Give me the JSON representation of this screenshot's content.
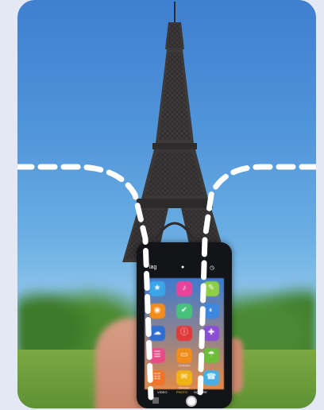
{
  "camera_ui": {
    "top_bar": {
      "hdr": "iag",
      "flash": "●",
      "timer": "◷"
    },
    "apps": [
      {
        "glyph": "★",
        "color": "#3aa5e8",
        "label": ""
      },
      {
        "glyph": "♪",
        "color": "#e8449b",
        "label": ""
      },
      {
        "glyph": "✎",
        "color": "#8fcf46",
        "label": ""
      },
      {
        "glyph": "◉",
        "color": "#f28c1a",
        "label": ""
      },
      {
        "glyph": "✔",
        "color": "#46c27a",
        "label": ""
      },
      {
        "glyph": "◐",
        "color": "#3c87e0",
        "label": ""
      },
      {
        "glyph": "☁",
        "color": "#2f6ed1",
        "label": ""
      },
      {
        "glyph": "ⓘ",
        "color": "#e03a3a",
        "label": ""
      },
      {
        "glyph": "✚",
        "color": "#8b4fd6",
        "label": ""
      },
      {
        "glyph": "☰",
        "color": "#e94b88",
        "label": ""
      },
      {
        "glyph": "▭",
        "color": "#f28c1a",
        "label": "Certificates"
      },
      {
        "glyph": "☂",
        "color": "#6bbd3a",
        "label": ""
      },
      {
        "glyph": "☷",
        "color": "#f0752b",
        "label": ""
      },
      {
        "glyph": "✉",
        "color": "#f1b416",
        "label": "Messages"
      },
      {
        "glyph": "☎",
        "color": "#46b0e6",
        "label": ""
      }
    ],
    "modes": {
      "video": "VIDEO",
      "photo": "PHOTO",
      "square": "SQUARE"
    }
  }
}
